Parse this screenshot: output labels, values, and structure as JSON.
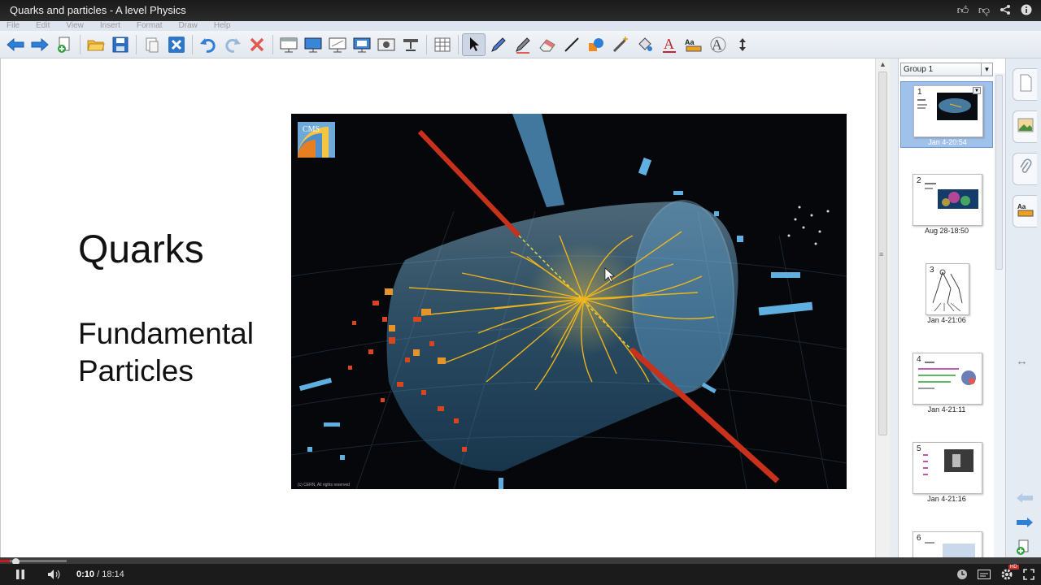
{
  "video": {
    "title": "Quarks and particles - A level Physics",
    "current_time": "0:10",
    "time_separator": "/",
    "duration": "18:14",
    "played_fraction": 0.009,
    "buffered_fraction": 0.064,
    "hd_badge": "HD"
  },
  "menu": [
    "File",
    "Edit",
    "View",
    "Insert",
    "Format",
    "Draw",
    "Help"
  ],
  "toolbar": {
    "icons": [
      "back-icon",
      "forward-icon",
      "add-page-icon",
      "open-icon",
      "save-icon",
      "paste-icon",
      "clear-page-icon",
      "undo-icon",
      "redo-icon",
      "delete-icon",
      "screen-shade-icon",
      "full-screen-icon",
      "dual-display-icon",
      "display-icon",
      "screen-capture-icon",
      "document-camera-icon",
      "table-icon",
      "select-icon",
      "pen-icon",
      "creative-pen-icon",
      "eraser-icon",
      "line-icon",
      "shapes-icon",
      "magic-pen-icon",
      "fill-icon",
      "text-icon",
      "properties-icon",
      "handwriting-icon",
      "move-toolbar-icon"
    ]
  },
  "slide": {
    "title": "Quarks",
    "subtitle_line1": "Fundamental",
    "subtitle_line2": "Particles",
    "logo_text": "CMS",
    "copyright": "(c) CERN, All rights reserved"
  },
  "sorter": {
    "group_label": "Group 1",
    "pages": [
      {
        "num": "1",
        "date": "Jan 4-20:54",
        "selected": true
      },
      {
        "num": "2",
        "date": "Aug 28-18:50",
        "selected": false
      },
      {
        "num": "3",
        "date": "Jan 4-21:06",
        "selected": false
      },
      {
        "num": "4",
        "date": "Jan 4-21:11",
        "selected": false
      },
      {
        "num": "5",
        "date": "Jan 4-21:16",
        "selected": false
      },
      {
        "num": "6",
        "date": "",
        "selected": false
      }
    ]
  },
  "colors": {
    "accent_selection": "#9fc1ea",
    "youtube_red": "#cc181e",
    "track_gold": "#f6b818",
    "detector_blue": "#6cb4e6"
  }
}
